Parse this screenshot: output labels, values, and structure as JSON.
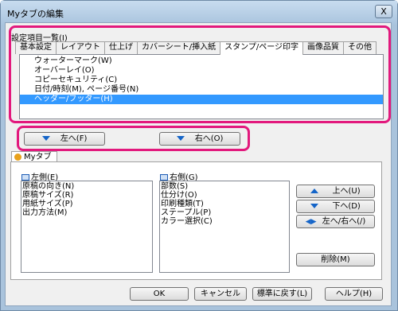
{
  "window": {
    "title": "Myタブの編集",
    "close_glyph": "X"
  },
  "section_label": "設定項目一覧(I)",
  "tabs": [
    "基本設定",
    "レイアウト",
    "仕上げ",
    "カバーシート/挿入紙",
    "スタンプ/ページ印字",
    "画像品質",
    "その他"
  ],
  "active_tab": 4,
  "items": [
    "ウォーターマーク(W)",
    "オーバーレイ(O)",
    "コピーセキュリティ(C)",
    "日付/時刻(M), ページ番号(N)",
    "ヘッダー/フッター(H)"
  ],
  "selected_item": 4,
  "move_left_label": "左へ(F)",
  "move_right_label": "右へ(O)",
  "mytab": {
    "tab_label": "Myタブ",
    "left": {
      "label": "左側(E)",
      "items": [
        "原稿の向き(N)",
        "原稿サイズ(R)",
        "用紙サイズ(P)",
        "出力方法(M)"
      ]
    },
    "right": {
      "label": "右側(G)",
      "items": [
        "部数(S)",
        "仕分け(O)",
        "印刷種類(T)",
        "ステープル(P)",
        "カラー選択(C)"
      ]
    },
    "up_label": "上へ(U)",
    "down_label": "下へ(D)",
    "lr_label": "左へ/右へ(/)",
    "delete_label": "削除(M)"
  },
  "footer": {
    "ok": "OK",
    "cancel": "キャンセル",
    "reset": "標準に戻す(L)",
    "help": "ヘルプ(H)"
  },
  "colors": {
    "highlight": "#e2197d",
    "selection": "#3399ff",
    "accent": "#1464c8"
  }
}
